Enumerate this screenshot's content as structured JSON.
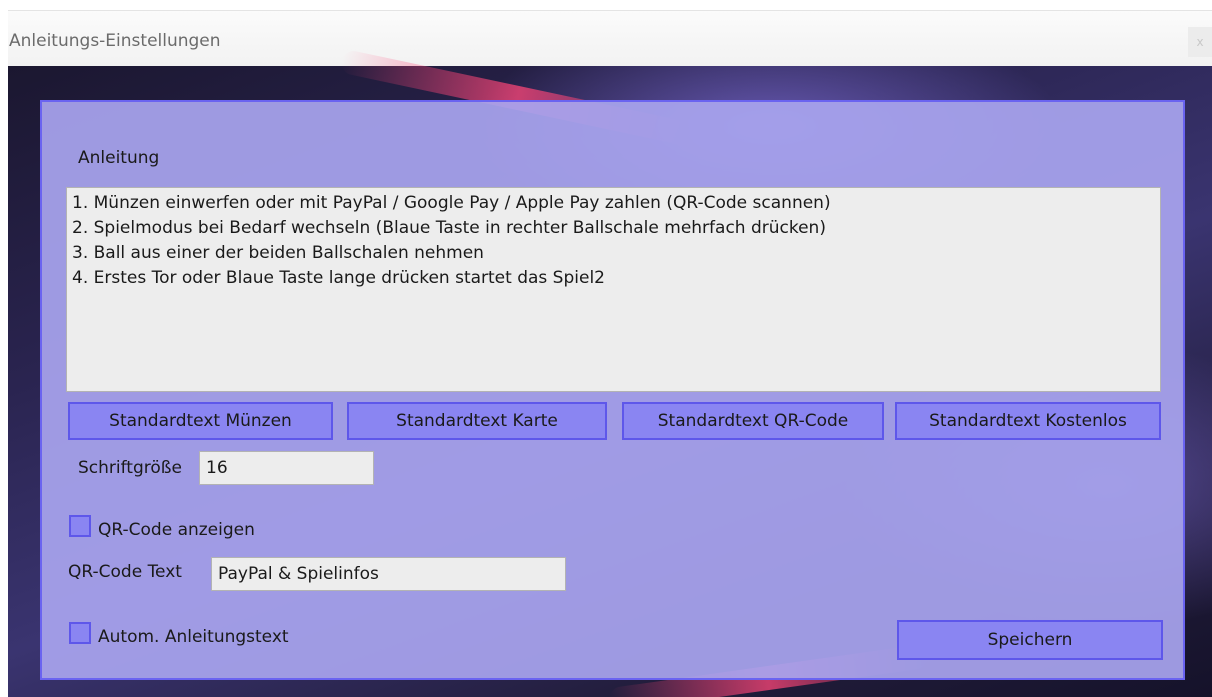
{
  "window": {
    "title": "Anleitungs-Einstellungen",
    "close_glyph": "x"
  },
  "instructions": {
    "label": "Anleitung",
    "lines": [
      "1. Münzen einwerfen oder mit PayPal / Google Pay / Apple Pay zahlen (QR-Code scannen)",
      "2. Spielmodus bei Bedarf wechseln (Blaue Taste in rechter Ballschale mehrfach drücken)",
      "3. Ball aus einer der beiden Ballschalen nehmen",
      "4. Erstes Tor oder Blaue Taste lange drücken startet das Spiel2"
    ]
  },
  "preset_buttons": [
    "Standardtext Münzen",
    "Standardtext Karte",
    "Standardtext QR-Code",
    "Standardtext Kostenlos"
  ],
  "font_size": {
    "label": "Schriftgröße",
    "value": "16"
  },
  "qr_show": {
    "label": "QR-Code anzeigen",
    "checked": false
  },
  "qr_text": {
    "label": "QR-Code Text",
    "value": "PayPal & Spielinfos"
  },
  "auto_text": {
    "label": "Autom. Anleitungstext",
    "checked": false
  },
  "save_label": "Speichern",
  "colors": {
    "panel": "#a8a4ee",
    "button": "#8a85f2",
    "button_border": "#5e57ea",
    "field": "#ededed"
  }
}
